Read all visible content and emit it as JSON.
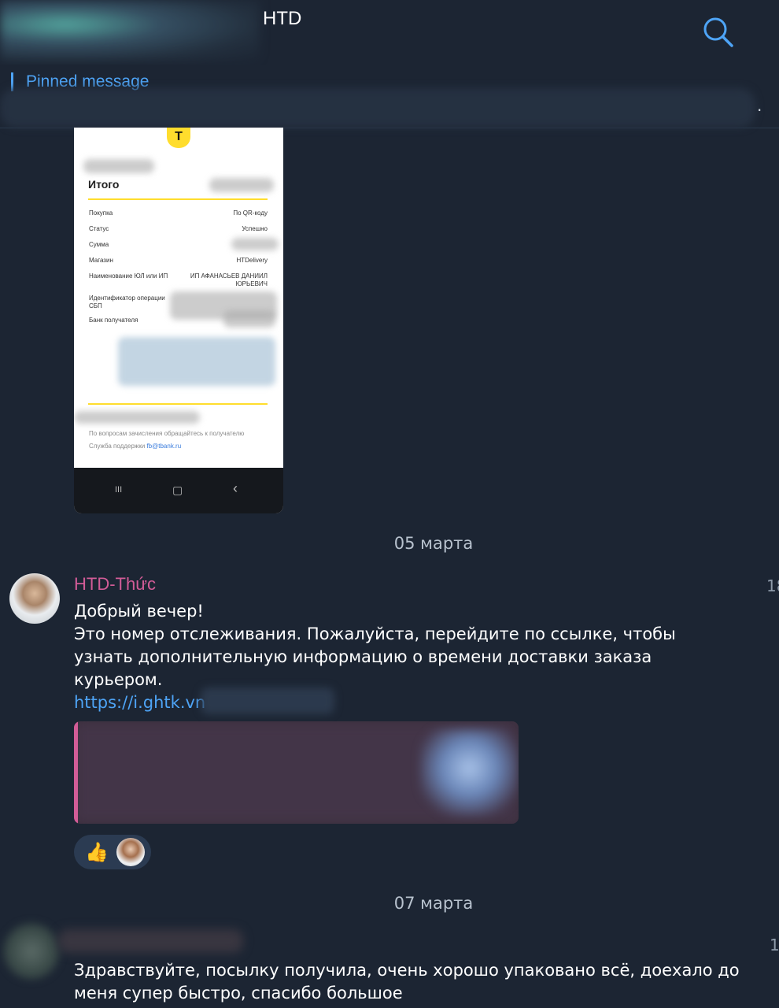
{
  "header": {
    "title": "HTD"
  },
  "pinned": {
    "label": "Pinned message",
    "trailing": "."
  },
  "receipt": {
    "logo_letter": "T",
    "total_label": "Итого",
    "rows": [
      {
        "label": "Покупка",
        "value": "По QR-коду"
      },
      {
        "label": "Статус",
        "value": "Успешно"
      },
      {
        "label": "Сумма",
        "value": ""
      },
      {
        "label": "Магазин",
        "value": "HTDelivery"
      },
      {
        "label": "Наименование ЮЛ или ИП",
        "value": "ИП АФАНАСЬЕВ ДАНИИЛ ЮРЬЕВИЧ"
      },
      {
        "label": "Идентификатор операции СБП",
        "value": ""
      },
      {
        "label": "Банк получателя",
        "value": ""
      }
    ],
    "footer_question": "По вопросам зачисления обращайтесь к получателю",
    "footer_support_prefix": "Служба поддержки",
    "footer_support_email": "fb@tbank.ru",
    "nav": {
      "recent": "III",
      "home": "▢",
      "back": "‹"
    }
  },
  "dates": {
    "first": "05 марта",
    "second": "07 марта"
  },
  "message1": {
    "sender": "HTD-Thức",
    "time_partial": "18",
    "line1": "Добрый вечер!",
    "line2": "Это номер отслеживания. Пожалуйста, перейдите по ссылке, чтобы узнать дополнительную информацию о времени доставки заказа курьером.",
    "link": "https://i.ghtk.vn",
    "reaction_emoji": "👍"
  },
  "message2": {
    "time_partial": "1",
    "text": "Здравствуйте, посылку получила, очень хорошо упаковано всё, доехало до меня супер быстро, спасибо большое"
  },
  "colors": {
    "background": "#1c2533",
    "accent": "#4ea4f6",
    "sender": "#d25c97"
  }
}
